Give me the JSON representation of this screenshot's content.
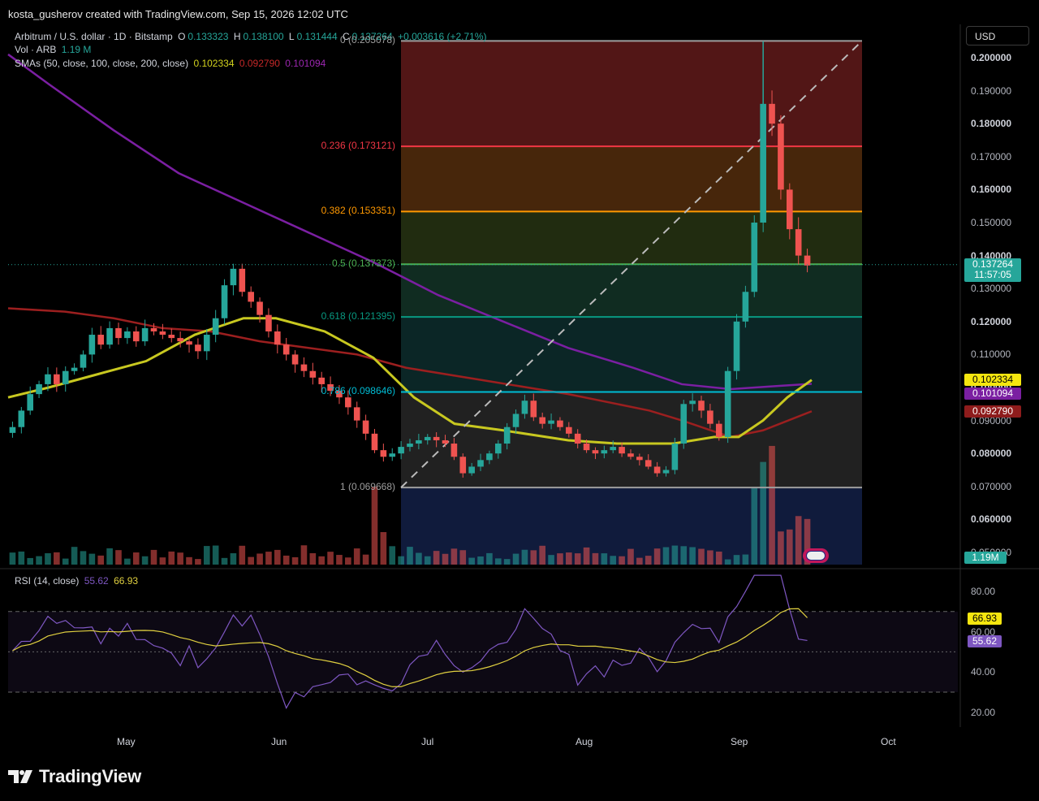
{
  "header": {
    "credit": "kosta_gusherov created with TradingView.com, Sep 15, 2026 12:02 UTC"
  },
  "legend": {
    "symbol": "Arbitrum / U.S. dollar · 1D · Bitstamp",
    "o_label": "O",
    "o_value": "0.133323",
    "h_label": "H",
    "h_value": "0.138100",
    "l_label": "L",
    "l_value": "0.131444",
    "c_label": "C",
    "c_value": "0.137264",
    "change": "+0.003616 (+2.71%)",
    "vol_label": "Vol · ARB",
    "vol_value": "1.19 M",
    "sma_label": "SMAs (50, close, 100, close, 200, close)",
    "sma50": "0.102334",
    "sma100": "0.092790",
    "sma200": "0.101094"
  },
  "rsi_legend": {
    "label": "RSI (14, close)",
    "rsi": "55.62",
    "rsi_ma": "66.93"
  },
  "currency": "USD",
  "y_axis": [
    "0.200000",
    "0.190000",
    "0.180000",
    "0.170000",
    "0.160000",
    "0.150000",
    "0.140000",
    "0.130000",
    "0.120000",
    "0.110000",
    "0.100000",
    "0.090000",
    "0.080000",
    "0.070000",
    "0.060000",
    "0.050000"
  ],
  "badges": {
    "price": "0.137264",
    "countdown": "11:57:05",
    "sma50": "0.102334",
    "sma200": "0.101094",
    "sma100": "0.092790",
    "volume": "1.19M",
    "rsi_ma": "66.93",
    "rsi": "55.62"
  },
  "rsi_axis": [
    "80.00",
    "60.00",
    "40.00",
    "20.00"
  ],
  "x_axis": [
    "May",
    "Jun",
    "Jul",
    "Aug",
    "Sep",
    "Oct"
  ],
  "fib_levels": [
    {
      "label": "0 (0.205078)",
      "color": "#9e9e9e"
    },
    {
      "label": "0.236 (0.173121)",
      "color": "#f23645"
    },
    {
      "label": "0.382 (0.153351)",
      "color": "#ff9800"
    },
    {
      "label": "0.5 (0.137373)",
      "color": "#4caf50"
    },
    {
      "label": "0.618 (0.121395)",
      "color": "#089981"
    },
    {
      "label": "0.786 (0.098646)",
      "color": "#00bcd4"
    },
    {
      "label": "1 (0.069668)",
      "color": "#9e9e9e"
    }
  ],
  "colors": {
    "up": "#26a69a",
    "down": "#ef5350",
    "sma50": "#c8c820",
    "sma100": "#9c1f1f",
    "sma200": "#7b1fa2",
    "rsi": "#7e57c2"
  },
  "chart_data": {
    "type": "candlestick",
    "symbol": "ARBUSD",
    "timeframe": "1D",
    "last_close": 0.137264,
    "fib_retracement": {
      "high": 0.205078,
      "low": 0.069668,
      "levels": [
        0,
        0.236,
        0.382,
        0.5,
        0.618,
        0.786,
        1
      ]
    },
    "sma": {
      "50": 0.102334,
      "100": 0.09279,
      "200": 0.101094
    },
    "rsi": {
      "value": 55.62,
      "ma": 66.93
    },
    "close_path": [
      [
        0.088,
        0.093,
        0.098,
        0.101,
        0.104,
        0.101,
        0.105,
        0.106,
        0.11,
        0.116,
        0.113,
        0.118,
        0.115,
        0.117,
        0.114,
        0.118,
        0.117,
        0.116,
        0.115,
        0.114,
        0.113,
        0.111,
        0.116,
        0.121,
        0.131,
        0.136,
        0.129,
        0.126,
        0.122,
        0.117,
        0.113,
        0.11,
        0.107,
        0.105,
        0.103,
        0.101,
        0.099,
        0.097,
        0.094,
        0.09,
        0.086,
        0.081,
        0.079,
        0.08,
        0.082,
        0.083,
        0.084,
        0.085,
        0.084,
        0.083,
        0.079,
        0.074,
        0.076,
        0.078,
        0.08,
        0.083,
        0.088,
        0.092,
        0.096,
        0.091,
        0.089,
        0.09,
        0.088,
        0.086,
        0.083,
        0.081,
        0.08,
        0.081,
        0.082,
        0.08,
        0.079,
        0.078,
        0.076,
        0.074,
        0.075,
        0.083,
        0.095,
        0.096,
        0.093,
        0.089,
        0.085,
        0.105,
        0.12,
        0.129,
        0.15,
        0.186,
        0.18,
        0.16,
        0.148,
        0.14,
        0.137
      ]
    ]
  }
}
